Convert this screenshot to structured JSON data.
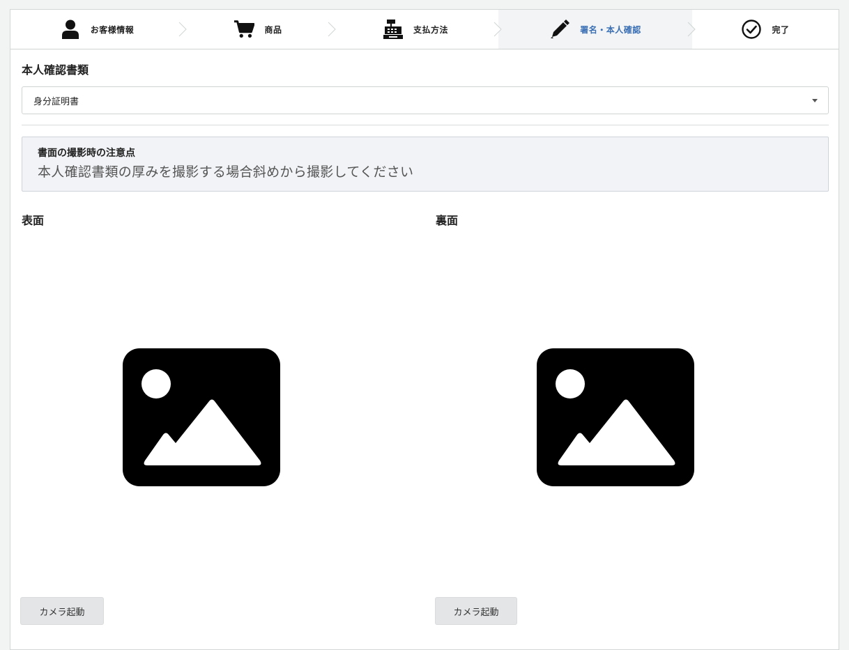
{
  "steps": [
    {
      "label": "お客様情報",
      "icon": "user-icon",
      "active": false
    },
    {
      "label": "商品",
      "icon": "cart-icon",
      "active": false
    },
    {
      "label": "支払方法",
      "icon": "cash-register-icon",
      "active": false
    },
    {
      "label": "署名・本人確認",
      "icon": "pen-icon",
      "active": true
    },
    {
      "label": "完了",
      "icon": "check-circle-icon",
      "active": false
    }
  ],
  "colors": {
    "active_step_text": "#3a6fb4",
    "active_step_bg": "#f2f4f6",
    "note_bg": "#f1f3f6",
    "button_bg": "#e3e5e7"
  },
  "document": {
    "title": "本人確認書類",
    "selected": "身分証明書"
  },
  "note": {
    "heading": "書面の撮影時の注意点",
    "body": "本人確認書類の厚みを撮影する場合斜めから撮影してください"
  },
  "front": {
    "label": "表面",
    "placeholder_icon": "image-placeholder-icon",
    "button": "カメラ起動"
  },
  "back": {
    "label": "裏面",
    "placeholder_icon": "image-placeholder-icon",
    "button": "カメラ起動"
  }
}
